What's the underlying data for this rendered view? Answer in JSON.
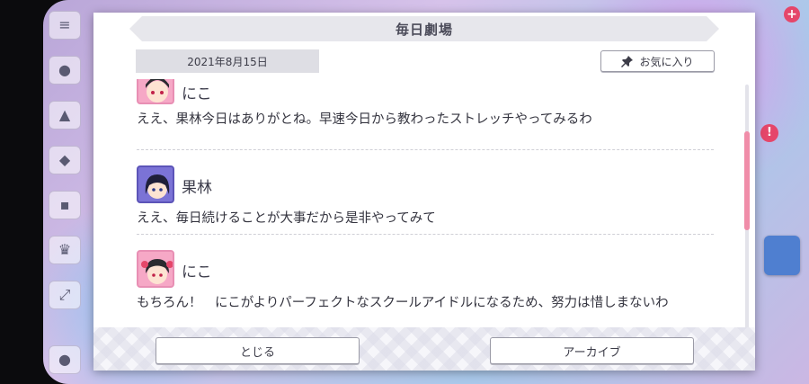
{
  "dialog": {
    "title": "毎日劇場",
    "date": "2021年8月15日",
    "favorite_label": "お気に入り",
    "close_label": "とじる",
    "archive_label": "アーカイブ"
  },
  "entries": [
    {
      "speaker": "にこ",
      "text": "ええ、果林今日はありがとね。早速今日から教わったストレッチやってみるわ"
    },
    {
      "speaker": "果林",
      "text": "ええ、毎日続けることが大事だから是非やってみて"
    },
    {
      "speaker": "にこ",
      "text": "もちろん！　にこがよりパーフェクトなスクールアイドルになるため、努力は惜しまないわ"
    }
  ],
  "icons": {
    "menu": "hamburger-icon",
    "favorite": "pin-icon",
    "hud_plus": "plus-icon"
  },
  "colors": {
    "accent_pink": "#f08da9",
    "nico_avatar": "#f6a8c6",
    "karin_avatar": "#7b73d6"
  }
}
